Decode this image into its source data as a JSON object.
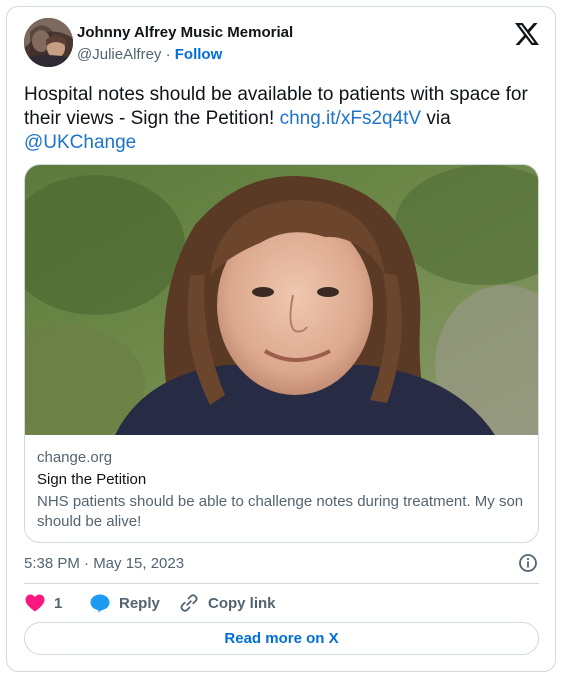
{
  "author": {
    "display_name": "Johnny Alfrey Music Memorial",
    "handle": "@JulieAlfrey",
    "separator": "·",
    "follow_label": "Follow",
    "avatar_icon": "avatar-photo"
  },
  "platform": {
    "logo_icon": "x-logo"
  },
  "tweet": {
    "text_lead": "Hospital notes should be available to patients with space for their views - Sign the Petition! ",
    "link_text": "chng.it/xFs2q4tV",
    "text_via": " via ",
    "mention": "@UKChange"
  },
  "link_card": {
    "domain": "change.org",
    "title": "Sign the Petition",
    "description": "NHS patients should be able to challenge notes during treatment. My son should be alive!"
  },
  "meta": {
    "timestamp": "5:38 PM · May 15, 2023",
    "info_icon": "info-icon"
  },
  "actions": {
    "like_count": "1",
    "reply_label": "Reply",
    "copy_label": "Copy link"
  },
  "read_more_label": "Read more on X",
  "colors": {
    "accent": "#006fd6",
    "link": "#1d74c9",
    "like": "#f91880",
    "reply": "#1d9bf0",
    "muted": "#536471",
    "border": "#cfd9de"
  }
}
